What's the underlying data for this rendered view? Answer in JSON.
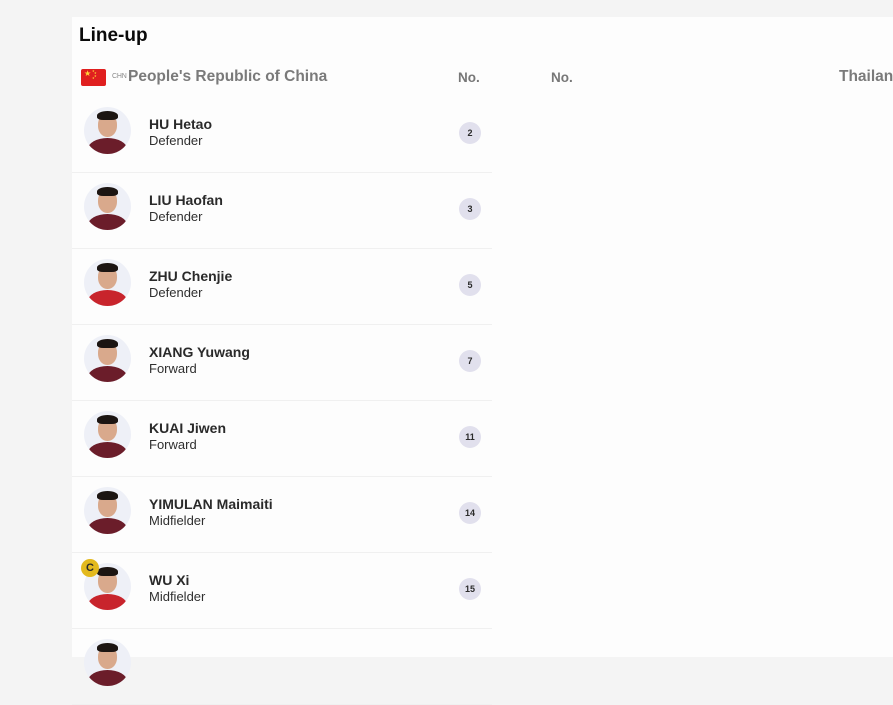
{
  "section_title": "Line-up",
  "home_team": {
    "code": "CHN",
    "name": "People's Republic of China",
    "number_header": "No.",
    "flag": {
      "icon": "china-flag-icon",
      "color": "#e01f1f",
      "star_color": "#ffd83a"
    }
  },
  "away_team": {
    "name": "Thailan",
    "number_header": "No."
  },
  "players": [
    {
      "name": "HU Hetao",
      "position": "Defender",
      "number": "2",
      "kit": "dark"
    },
    {
      "name": "LIU Haofan",
      "position": "Defender",
      "number": "3",
      "kit": "dark"
    },
    {
      "name": "ZHU Chenjie",
      "position": "Defender",
      "number": "5",
      "kit": "red"
    },
    {
      "name": "XIANG Yuwang",
      "position": "Forward",
      "number": "7",
      "kit": "dark"
    },
    {
      "name": "KUAI Jiwen",
      "position": "Forward",
      "number": "11",
      "kit": "dark"
    },
    {
      "name": "YIMULAN Maimaiti",
      "position": "Midfielder",
      "number": "14",
      "kit": "dark"
    },
    {
      "name": "WU Xi",
      "position": "Midfielder",
      "number": "15",
      "kit": "red",
      "captain_badge": "C"
    },
    {
      "name": "",
      "position": "",
      "number": "",
      "kit": "dark"
    }
  ],
  "colors": {
    "number_badge_bg": "#e1e0ed",
    "captain_badge_bg": "#e3b91e",
    "dark_kit": "#6b1d2a",
    "red_kit": "#c8242c"
  }
}
